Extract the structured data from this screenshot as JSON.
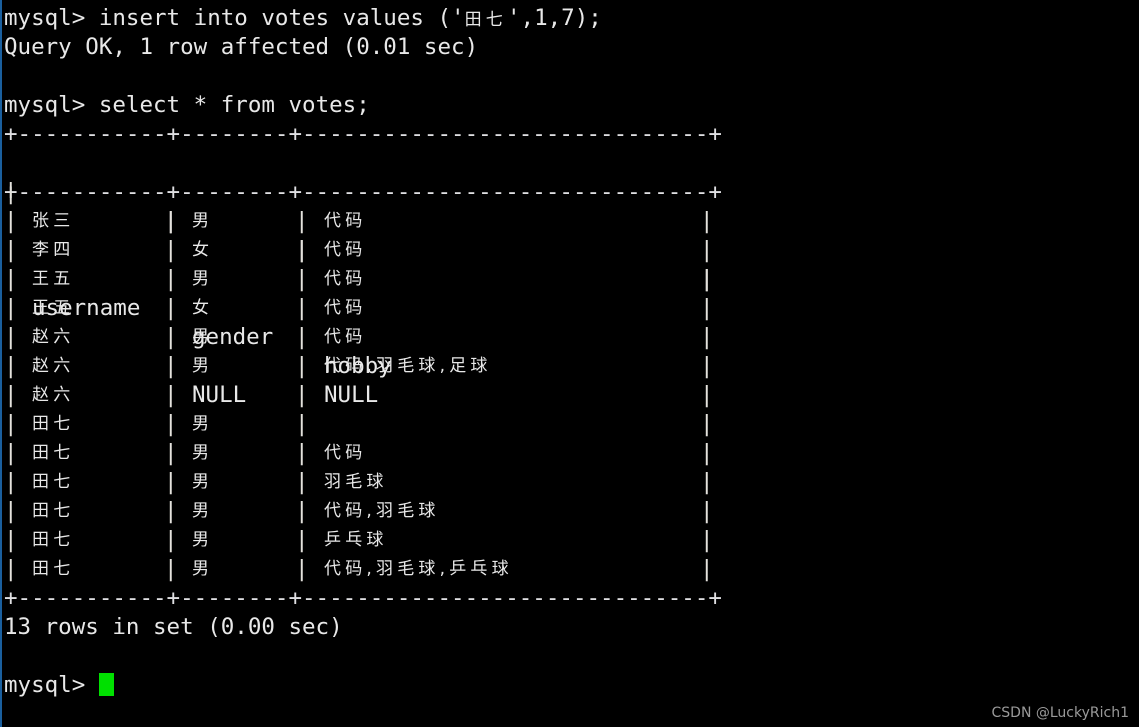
{
  "terminal": {
    "prompt": "mysql> ",
    "background": "#000000",
    "foreground": "#e8e8e8",
    "cursor_color": "#00e000",
    "lines": [
      {
        "type": "command",
        "prompt": "mysql> ",
        "text": "insert into votes values ('田七',1,7);"
      },
      {
        "type": "output",
        "text": "Query OK, 1 row affected (0.01 sec)"
      },
      {
        "type": "blank",
        "text": ""
      },
      {
        "type": "command",
        "prompt": "mysql> ",
        "text": "select * from votes;"
      }
    ],
    "result_footer": "13 rows in set (0.00 sec)",
    "final_prompt": "mysql> "
  },
  "table": {
    "rule": "+-----------+--------+------------------------------+",
    "columns": [
      "username",
      "gender",
      "hobby"
    ],
    "rows": [
      {
        "username": "张三",
        "gender": "男",
        "hobby": "代码"
      },
      {
        "username": "李四",
        "gender": "女",
        "hobby": "代码"
      },
      {
        "username": "王五",
        "gender": "男",
        "hobby": "代码"
      },
      {
        "username": "王五",
        "gender": "女",
        "hobby": "代码"
      },
      {
        "username": "赵六",
        "gender": "男",
        "hobby": "代码"
      },
      {
        "username": "赵六",
        "gender": "男",
        "hobby": "代码,羽毛球,足球"
      },
      {
        "username": "赵六",
        "gender": "NULL",
        "hobby": "NULL"
      },
      {
        "username": "田七",
        "gender": "男",
        "hobby": ""
      },
      {
        "username": "田七",
        "gender": "男",
        "hobby": "代码"
      },
      {
        "username": "田七",
        "gender": "男",
        "hobby": "羽毛球"
      },
      {
        "username": "田七",
        "gender": "男",
        "hobby": "代码,羽毛球"
      },
      {
        "username": "田七",
        "gender": "男",
        "hobby": "乒乓球"
      },
      {
        "username": "田七",
        "gender": "男",
        "hobby": "代码,羽毛球,乒乓球"
      }
    ],
    "row_count": 13
  },
  "watermark": {
    "text": "CSDN @LuckyRich1"
  }
}
